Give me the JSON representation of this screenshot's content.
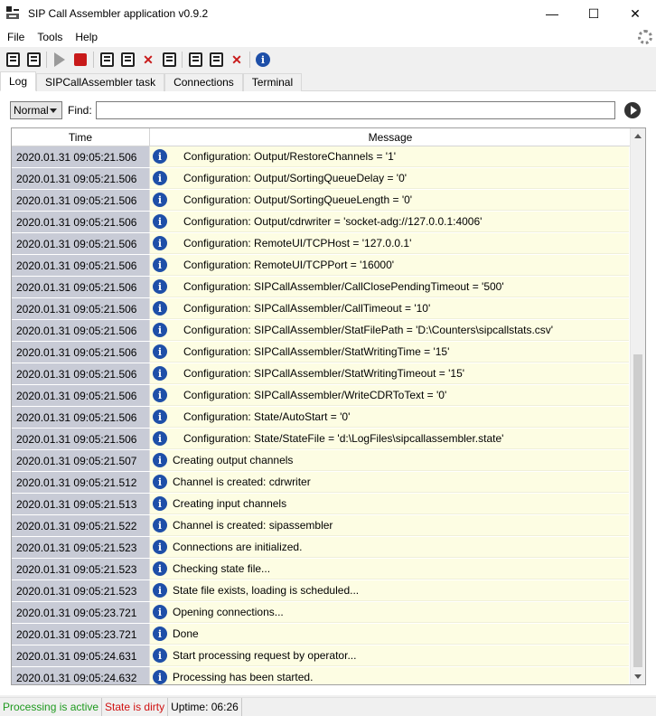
{
  "window": {
    "title": "SIP Call Assembler application v0.9.2",
    "minimize": "—",
    "maximize": "☐",
    "close": "✕"
  },
  "menu": [
    "File",
    "Tools",
    "Help"
  ],
  "toolbar": {
    "icons": [
      "log-icon",
      "log-save-icon",
      "start-icon",
      "stop-icon",
      "export-icon",
      "export-all-icon",
      "delete-icon",
      "print-icon",
      "settings-icon",
      "settings-edit-icon",
      "settings-delete-icon",
      "about-icon"
    ],
    "info_glyph": "i",
    "x_glyph": "✕"
  },
  "tabs": [
    "Log",
    "SIPCallAssembler task",
    "Connections",
    "Terminal"
  ],
  "active_tab": "Log",
  "filter": {
    "level": "Normal",
    "find_label": "Find:",
    "find_value": ""
  },
  "grid": {
    "headers": {
      "time": "Time",
      "message": "Message"
    },
    "rows": [
      {
        "time": "2020.01.31 09:05:21.506",
        "message": "Configuration: Output/RestoreChannels = '1'",
        "indent": true
      },
      {
        "time": "2020.01.31 09:05:21.506",
        "message": "Configuration: Output/SortingQueueDelay = '0'",
        "indent": true
      },
      {
        "time": "2020.01.31 09:05:21.506",
        "message": "Configuration: Output/SortingQueueLength = '0'",
        "indent": true
      },
      {
        "time": "2020.01.31 09:05:21.506",
        "message": "Configuration: Output/cdrwriter = 'socket-adg://127.0.0.1:4006'",
        "indent": true
      },
      {
        "time": "2020.01.31 09:05:21.506",
        "message": "Configuration: RemoteUI/TCPHost = '127.0.0.1'",
        "indent": true
      },
      {
        "time": "2020.01.31 09:05:21.506",
        "message": "Configuration: RemoteUI/TCPPort = '16000'",
        "indent": true
      },
      {
        "time": "2020.01.31 09:05:21.506",
        "message": "Configuration: SIPCallAssembler/CallClosePendingTimeout = '500'",
        "indent": true
      },
      {
        "time": "2020.01.31 09:05:21.506",
        "message": "Configuration: SIPCallAssembler/CallTimeout = '10'",
        "indent": true
      },
      {
        "time": "2020.01.31 09:05:21.506",
        "message": "Configuration: SIPCallAssembler/StatFilePath = 'D:\\Counters\\sipcallstats.csv'",
        "indent": true
      },
      {
        "time": "2020.01.31 09:05:21.506",
        "message": "Configuration: SIPCallAssembler/StatWritingTime = '15'",
        "indent": true
      },
      {
        "time": "2020.01.31 09:05:21.506",
        "message": "Configuration: SIPCallAssembler/StatWritingTimeout = '15'",
        "indent": true
      },
      {
        "time": "2020.01.31 09:05:21.506",
        "message": "Configuration: SIPCallAssembler/WriteCDRToText = '0'",
        "indent": true
      },
      {
        "time": "2020.01.31 09:05:21.506",
        "message": "Configuration: State/AutoStart = '0'",
        "indent": true
      },
      {
        "time": "2020.01.31 09:05:21.506",
        "message": "Configuration: State/StateFile = 'd:\\LogFiles\\sipcallassembler.state'",
        "indent": true
      },
      {
        "time": "2020.01.31 09:05:21.507",
        "message": "Creating output channels",
        "indent": false
      },
      {
        "time": "2020.01.31 09:05:21.512",
        "message": "Channel is created: cdrwriter",
        "indent": false
      },
      {
        "time": "2020.01.31 09:05:21.513",
        "message": "Creating input channels",
        "indent": false
      },
      {
        "time": "2020.01.31 09:05:21.522",
        "message": "Channel is created: sipassembler",
        "indent": false
      },
      {
        "time": "2020.01.31 09:05:21.523",
        "message": "Connections are initialized.",
        "indent": false
      },
      {
        "time": "2020.01.31 09:05:21.523",
        "message": "Checking state file...",
        "indent": false
      },
      {
        "time": "2020.01.31 09:05:21.523",
        "message": "State file exists, loading is scheduled...",
        "indent": false
      },
      {
        "time": "2020.01.31 09:05:23.721",
        "message": "Opening connections...",
        "indent": false
      },
      {
        "time": "2020.01.31 09:05:23.721",
        "message": "Done",
        "indent": false
      },
      {
        "time": "2020.01.31 09:05:24.631",
        "message": "Start processing request by operator...",
        "indent": false
      },
      {
        "time": "2020.01.31 09:05:24.632",
        "message": "Processing has been started.",
        "indent": false
      }
    ]
  },
  "status": {
    "processing": "Processing is active",
    "state": "State is dirty",
    "uptime": "Uptime: 06:26"
  },
  "colors": {
    "info_blue": "#1e4fa8",
    "time_bg": "#c8cbd6",
    "message_bg": "#fdfde3",
    "status_green": "#1f9a1f",
    "status_red": "#d01010",
    "stop_red": "#c81a1a"
  }
}
